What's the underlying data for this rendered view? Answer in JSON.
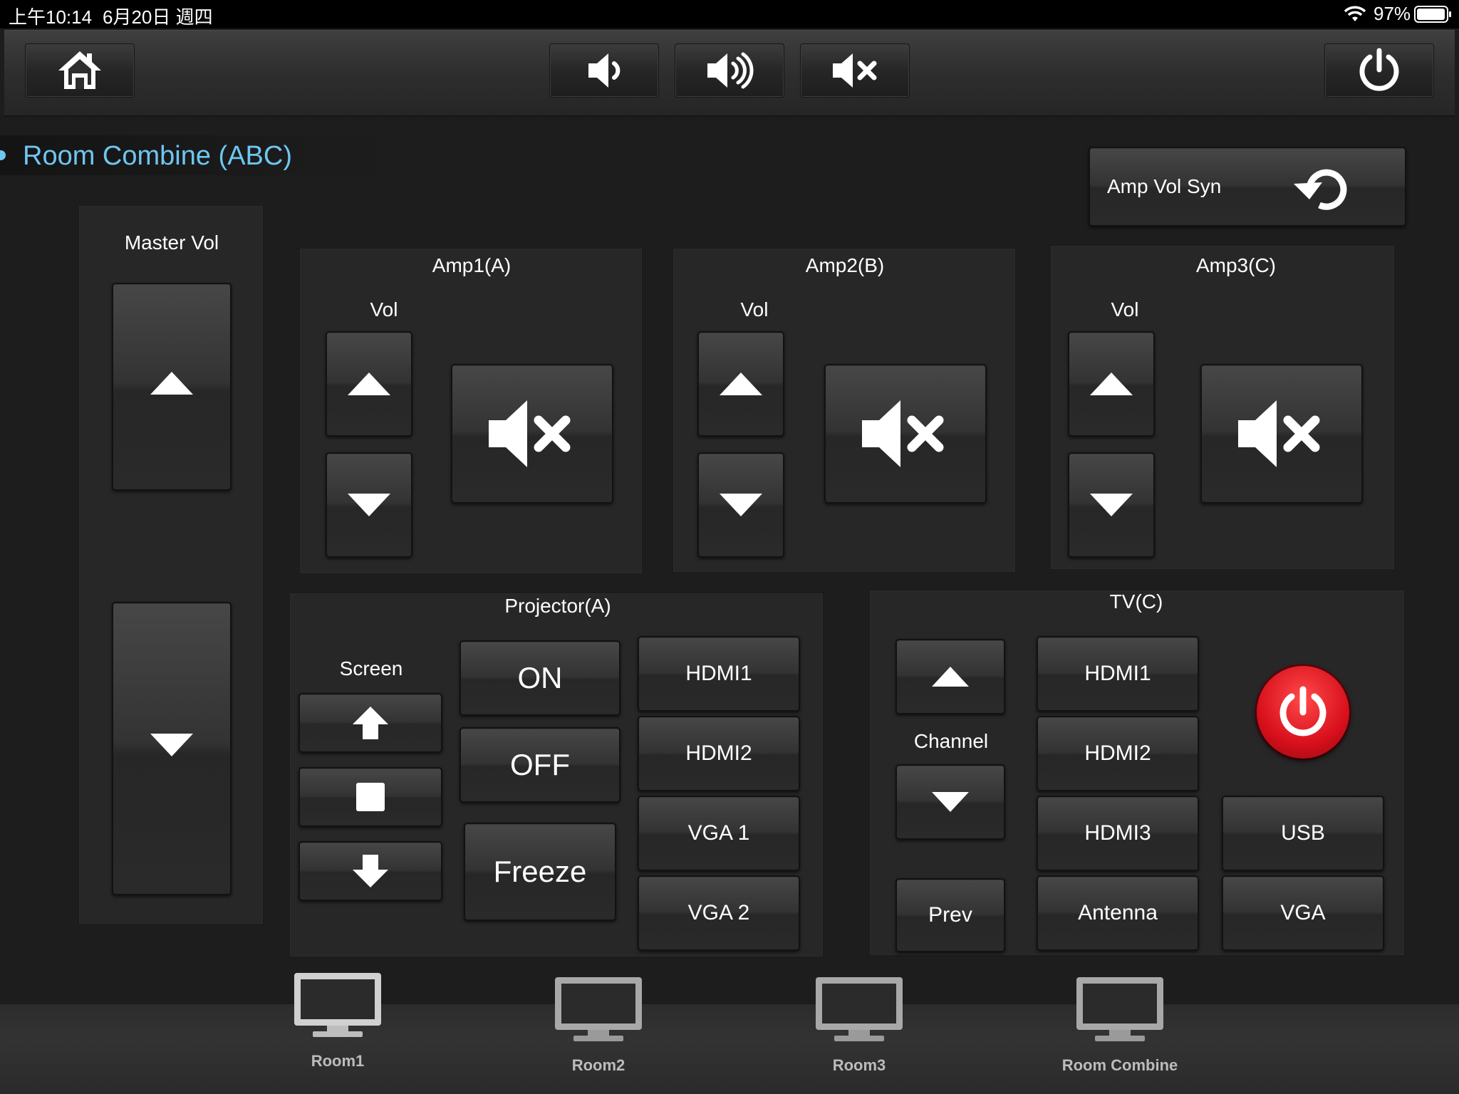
{
  "status_bar": {
    "time": "上午10:14",
    "date": "6月20日 週四",
    "battery": "97%"
  },
  "colors": {
    "accent": "#6ec6f0",
    "power_red": "#d8101c"
  },
  "toolbar": {
    "icons": [
      "home-icon",
      "volume-down-icon",
      "volume-up-icon",
      "mute-icon",
      "power-icon"
    ]
  },
  "page": {
    "title": "Room Combine (ABC)"
  },
  "amp_sync": {
    "label": "Amp Vol Syn",
    "icon": "refresh-icon"
  },
  "master": {
    "label": "Master Vol"
  },
  "amps": [
    {
      "name": "Amp1(A)",
      "vol_label": "Vol"
    },
    {
      "name": "Amp2(B)",
      "vol_label": "Vol"
    },
    {
      "name": "Amp3(C)",
      "vol_label": "Vol"
    }
  ],
  "projector": {
    "title": "Projector(A)",
    "screen_label": "Screen",
    "on": "ON",
    "off": "OFF",
    "freeze": "Freeze",
    "sources": [
      "HDMI1",
      "HDMI2",
      "VGA 1",
      "VGA 2"
    ]
  },
  "tv": {
    "title": "TV(C)",
    "channel_label": "Channel",
    "prev": "Prev",
    "sources": [
      "HDMI1",
      "HDMI2",
      "HDMI3",
      "Antenna"
    ],
    "usb": "USB",
    "vga": "VGA"
  },
  "rooms": [
    "Room1",
    "Room2",
    "Room3",
    "Room Combine"
  ]
}
